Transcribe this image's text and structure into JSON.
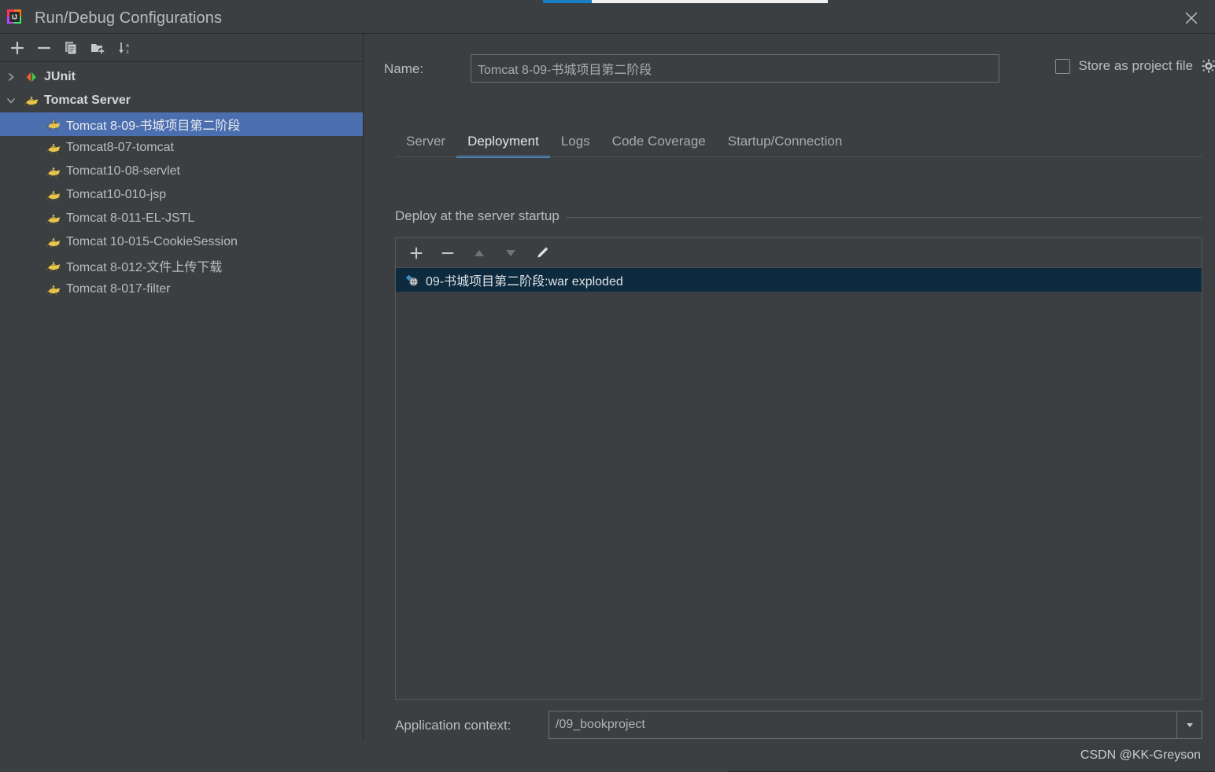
{
  "window": {
    "title": "Run/Debug Configurations",
    "app_icon": "intellij-idea-logo",
    "close_icon": "close-icon"
  },
  "top_progress": {
    "blue_segment_color": "#1a7cc4",
    "white_segment_color": "#f0f0f0"
  },
  "colors": {
    "background": "#3c3f41",
    "tree_selection": "#4b6eaf",
    "list_selection": "#0d2a3f",
    "tab_accent": "#4a88c7",
    "text": "#b9bcbd"
  },
  "left_panel": {
    "toolbar": [
      {
        "name": "add-configuration-button",
        "icon": "plus-icon",
        "label": "Add New Configuration"
      },
      {
        "name": "remove-configuration-button",
        "icon": "minus-icon",
        "label": "Remove Configuration"
      },
      {
        "name": "copy-configuration-button",
        "icon": "copy-icon",
        "label": "Copy Configuration"
      },
      {
        "name": "save-configuration-button",
        "icon": "folder-add-icon",
        "label": "Save Configuration"
      },
      {
        "name": "sort-configurations-button",
        "icon": "sort-alpha-icon",
        "label": "Sort Configurations"
      }
    ],
    "tree": [
      {
        "label": "JUnit",
        "type": "group",
        "icon": "junit-icon",
        "expanded": false,
        "selected": false
      },
      {
        "label": "Tomcat Server",
        "type": "group",
        "icon": "tomcat-icon",
        "expanded": true,
        "selected": false
      },
      {
        "label": "Tomcat 8-09-书城项目第二阶段",
        "type": "child",
        "icon": "tomcat-icon",
        "selected": true
      },
      {
        "label": "Tomcat8-07-tomcat",
        "type": "child",
        "icon": "tomcat-icon",
        "selected": false
      },
      {
        "label": "Tomcat10-08-servlet",
        "type": "child",
        "icon": "tomcat-icon",
        "selected": false
      },
      {
        "label": "Tomcat10-010-jsp",
        "type": "child",
        "icon": "tomcat-icon",
        "selected": false
      },
      {
        "label": "Tomcat 8-011-EL-JSTL",
        "type": "child",
        "icon": "tomcat-icon",
        "selected": false
      },
      {
        "label": "Tomcat 10-015-CookieSession",
        "type": "child",
        "icon": "tomcat-icon",
        "selected": false
      },
      {
        "label": "Tomcat 8-012-文件上传下载",
        "type": "child",
        "icon": "tomcat-icon",
        "selected": false
      },
      {
        "label": "Tomcat 8-017-filter",
        "type": "child",
        "icon": "tomcat-icon",
        "selected": false
      }
    ]
  },
  "right_panel": {
    "name_label": "Name:",
    "name_value": "Tomcat 8-09-书城项目第二阶段",
    "name_placeholder": "",
    "store_as_project_file_label": "Store as project file",
    "store_as_project_file_checked": false,
    "store_gear_icon": "gear-icon",
    "tabs": [
      {
        "label": "Server",
        "active": false
      },
      {
        "label": "Deployment",
        "active": true
      },
      {
        "label": "Logs",
        "active": false
      },
      {
        "label": "Code Coverage",
        "active": false
      },
      {
        "label": "Startup/Connection",
        "active": false
      }
    ],
    "deploy_group_title": "Deploy at the server startup",
    "deploy_toolbar": [
      {
        "name": "add-artifact-button",
        "icon": "plus-icon",
        "enabled": true
      },
      {
        "name": "remove-artifact-button",
        "icon": "minus-icon",
        "enabled": true
      },
      {
        "name": "move-up-button",
        "icon": "arrow-up-icon",
        "enabled": false
      },
      {
        "name": "move-down-button",
        "icon": "arrow-down-icon",
        "enabled": false
      },
      {
        "name": "edit-artifact-button",
        "icon": "pencil-icon",
        "enabled": true
      }
    ],
    "deploy_items": [
      {
        "label": "09-书城项目第二阶段:war exploded",
        "icon": "artifact-icon",
        "selected": true
      }
    ],
    "application_context_label": "Application context:",
    "application_context_value": "/09_bookproject",
    "application_context_dropdown_icon": "chevron-down-icon"
  },
  "watermark": "CSDN @KK-Greyson"
}
